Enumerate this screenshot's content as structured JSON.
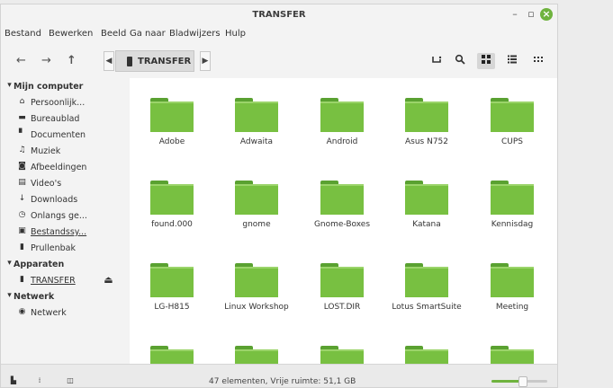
{
  "window": {
    "title": "TRANSFER"
  },
  "menu": [
    "Bestand",
    "Bewerken",
    "Beeld",
    "Ga naar",
    "Bladwijzers",
    "Hulp"
  ],
  "toolbar": {
    "back": "←",
    "forward": "→",
    "up": "↑",
    "crumb_left": "◀",
    "crumb_right": "▶",
    "location": "TRANSFER",
    "icons": [
      "terminal-icon",
      "search-icon",
      "icon-view-icon",
      "list-view-icon",
      "compact-view-icon"
    ],
    "active_view": "icon-view"
  },
  "sidebar": {
    "sections": [
      {
        "label": "Mijn computer",
        "items": [
          {
            "label": "Persoonlijk...",
            "icon": "home-icon"
          },
          {
            "label": "Bureaublad",
            "icon": "desktop-icon"
          },
          {
            "label": "Documenten",
            "icon": "document-icon"
          },
          {
            "label": "Muziek",
            "icon": "music-icon"
          },
          {
            "label": "Afbeeldingen",
            "icon": "camera-icon"
          },
          {
            "label": "Video's",
            "icon": "video-icon"
          },
          {
            "label": "Downloads",
            "icon": "download-icon"
          },
          {
            "label": "Onlangs ge...",
            "icon": "recent-icon"
          },
          {
            "label": "Bestandssy...",
            "icon": "drive-icon"
          },
          {
            "label": "Prullenbak",
            "icon": "trash-icon"
          }
        ]
      },
      {
        "label": "Apparaten",
        "items": [
          {
            "label": "TRANSFER",
            "icon": "usb-drive-icon",
            "eject": "⏏"
          }
        ]
      },
      {
        "label": "Netwerk",
        "items": [
          {
            "label": "Netwerk",
            "icon": "network-icon"
          }
        ]
      }
    ]
  },
  "folders": [
    "Adobe",
    "Adwaita",
    "Android",
    "Asus N752",
    "CUPS",
    "found.000",
    "gnome",
    "Gnome-Boxes",
    "Katana",
    "Kennisdag",
    "LG-H815",
    "Linux Workshop",
    "LOST.DIR",
    "Lotus SmartSuite",
    "Meeting",
    "",
    "",
    "",
    "",
    ""
  ],
  "status": {
    "text": "47 elementen, Vrije ruimte: 51,1 GB",
    "zoom_level": 0.55
  },
  "colors": {
    "folder": "#78c041",
    "accent": "#6fb33e"
  }
}
